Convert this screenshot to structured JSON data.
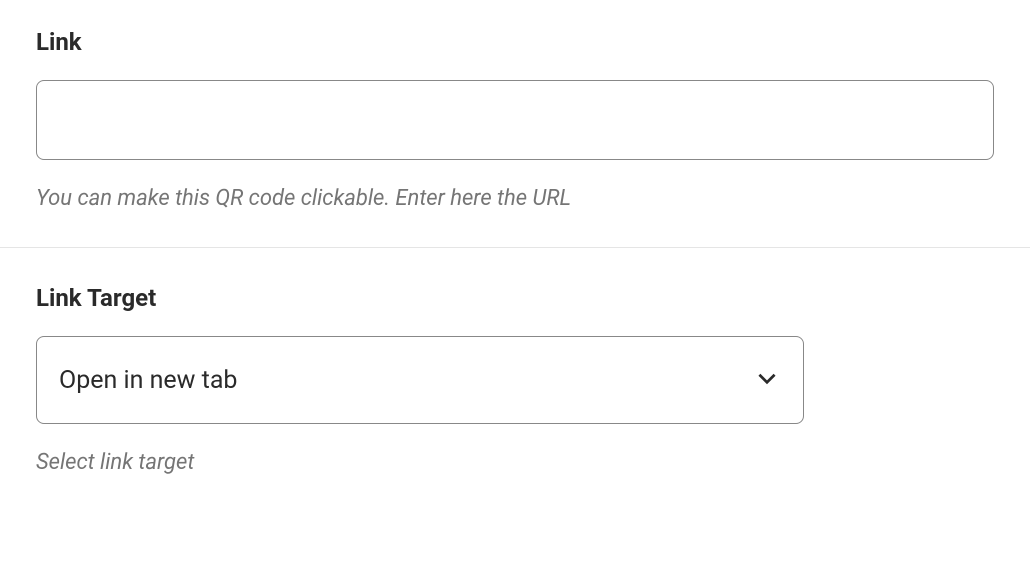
{
  "link": {
    "label": "Link",
    "value": "",
    "help": "You can make this QR code clickable. Enter here the URL"
  },
  "linkTarget": {
    "label": "Link Target",
    "selected": "Open in new tab",
    "help": "Select link target"
  }
}
